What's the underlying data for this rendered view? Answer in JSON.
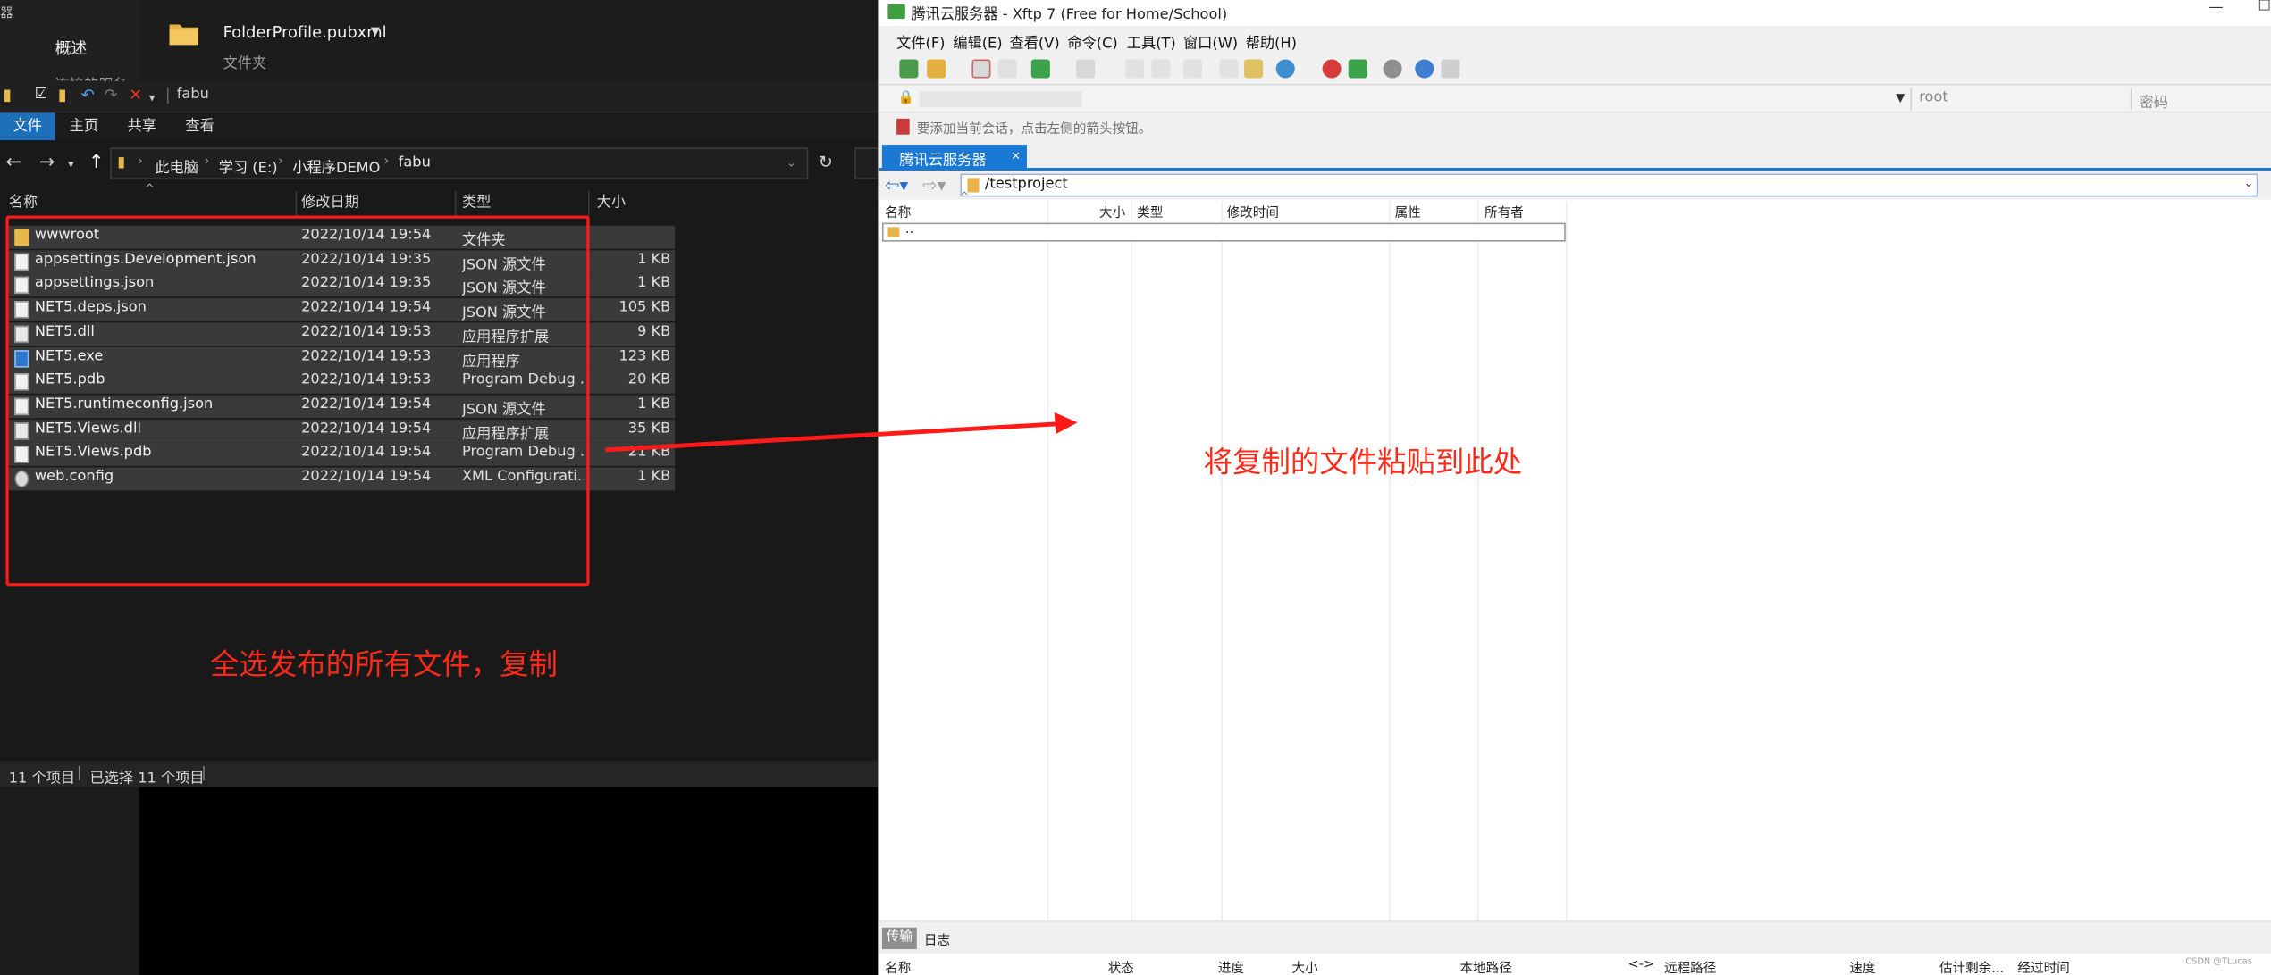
{
  "explorer": {
    "backstage": {
      "overview": "概述",
      "overview2": "连接的服务器"
    },
    "profile": {
      "name": "FolderProfile.pubxml",
      "type": "文件夹"
    },
    "qat": {
      "title": "fabu"
    },
    "ribbon": {
      "tabs": [
        "文件",
        "主页",
        "共享",
        "查看"
      ]
    },
    "address": {
      "crumbs": [
        "此电脑",
        "学习 (E:)",
        "小程序DEMO",
        "fabu"
      ]
    },
    "columns": {
      "name": "名称",
      "date": "修改日期",
      "type": "类型",
      "size": "大小"
    },
    "files": [
      {
        "name": "wwwroot",
        "date": "2022/10/14 19:54",
        "type": "文件夹",
        "size": "",
        "icon": "folder-icon"
      },
      {
        "name": "appsettings.Development.json",
        "date": "2022/10/14 19:35",
        "type": "JSON 源文件",
        "size": "1 KB",
        "icon": "json-file-icon"
      },
      {
        "name": "appsettings.json",
        "date": "2022/10/14 19:35",
        "type": "JSON 源文件",
        "size": "1 KB",
        "icon": "json-file-icon"
      },
      {
        "name": "NET5.deps.json",
        "date": "2022/10/14 19:54",
        "type": "JSON 源文件",
        "size": "105 KB",
        "icon": "json-file-icon"
      },
      {
        "name": "NET5.dll",
        "date": "2022/10/14 19:53",
        "type": "应用程序扩展",
        "size": "9 KB",
        "icon": "dll-file-icon"
      },
      {
        "name": "NET5.exe",
        "date": "2022/10/14 19:53",
        "type": "应用程序",
        "size": "123 KB",
        "icon": "exe-file-icon"
      },
      {
        "name": "NET5.pdb",
        "date": "2022/10/14 19:53",
        "type": "Program Debug ...",
        "size": "20 KB",
        "icon": "pdb-file-icon"
      },
      {
        "name": "NET5.runtimeconfig.json",
        "date": "2022/10/14 19:54",
        "type": "JSON 源文件",
        "size": "1 KB",
        "icon": "json-file-icon"
      },
      {
        "name": "NET5.Views.dll",
        "date": "2022/10/14 19:54",
        "type": "应用程序扩展",
        "size": "35 KB",
        "icon": "dll-file-icon"
      },
      {
        "name": "NET5.Views.pdb",
        "date": "2022/10/14 19:54",
        "type": "Program Debug ...",
        "size": "21 KB",
        "icon": "pdb-file-icon"
      },
      {
        "name": "web.config",
        "date": "2022/10/14 19:54",
        "type": "XML Configurati...",
        "size": "1 KB",
        "icon": "config-file-icon"
      }
    ],
    "annotation": "全选发布的所有文件，复制",
    "status": {
      "count": "11 个项目",
      "selected": "已选择 11 个项目"
    }
  },
  "xftp": {
    "title": "腾讯云服务器 - Xftp 7 (Free for Home/School)",
    "menu": [
      "文件(F)",
      "编辑(E)",
      "查看(V)",
      "命令(C)",
      "工具(T)",
      "窗口(W)",
      "帮助(H)"
    ],
    "address": {
      "user_placeholder": "root",
      "password_placeholder": "密码"
    },
    "hint": "要添加当前会话，点击左侧的箭头按钮。",
    "tab": {
      "label": "腾讯云服务器",
      "close": "×"
    },
    "path": "/testproject",
    "columns": {
      "name": "名称",
      "size": "大小",
      "type": "类型",
      "modified": "修改时间",
      "attr": "属性",
      "owner": "所有者"
    },
    "updir": "..",
    "annotation": "将复制的文件粘贴到此处",
    "bottom": {
      "tabs": {
        "transfer": "传输",
        "log": "日志"
      },
      "columns": {
        "name": "名称",
        "status": "状态",
        "progress": "进度",
        "size": "大小",
        "local": "本地路径",
        "dir": "<->",
        "remote": "远程路径",
        "speed": "速度",
        "eta": "估计剩余...",
        "elapsed": "经过时间"
      },
      "watermark": "CSDN @TLucas"
    }
  },
  "colors": {
    "accent": "#1b79d6",
    "annotation_red": "#ff2a1a",
    "explorer_bg": "#191919"
  }
}
